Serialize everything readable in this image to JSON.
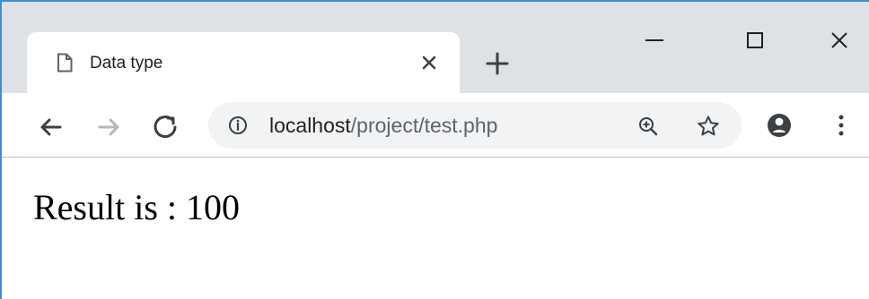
{
  "browser": {
    "tab": {
      "title": "Data type",
      "icon": "document-icon"
    },
    "controls": {
      "new_tab_icon": "plus-icon",
      "minimize_icon": "minimize-icon",
      "maximize_icon": "maximize-icon",
      "close_icon": "close-icon"
    },
    "toolbar": {
      "back_icon": "back-arrow-icon",
      "forward_icon": "forward-arrow-icon",
      "reload_icon": "reload-icon",
      "address": {
        "host": "localhost",
        "path": "/project/test.php",
        "security_icon": "info-icon"
      },
      "zoom_icon": "zoom-in-icon",
      "bookmark_icon": "star-icon",
      "account_icon": "account-icon",
      "menu_icon": "more-menu-icon"
    },
    "colors": {
      "chrome_frame": "#dee1e6",
      "omnibox_background": "#f1f3f4",
      "window_border": "#3c8ddb",
      "text": "#202124",
      "url_path": "#5f6368"
    }
  },
  "page": {
    "result_text": "Result is : 100"
  }
}
